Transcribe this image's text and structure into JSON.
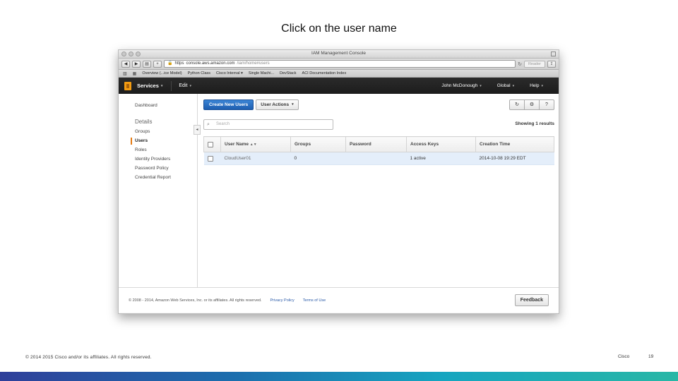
{
  "slide": {
    "title": "Click on the user name",
    "copyright": "© 2014 2015 Cisco and/or its affiliates. All rights reserved.",
    "company": "Cisco",
    "page_number": "19"
  },
  "browser": {
    "window_title": "IAM Management Console",
    "url_scheme": "https",
    "url_host": "console.aws.amazon.com",
    "url_path": "/iam/home#users",
    "reader_label": "Reader",
    "bookmarks": [
      "Overview (...ice Model)",
      "Python Class",
      "Cisco Internal ▾",
      "Single Machi...",
      "DevStack",
      "ACI Documentation Index"
    ]
  },
  "aws_nav": {
    "services_label": "Services",
    "edit_label": "Edit",
    "user_label": "John McDonough",
    "region_label": "Global",
    "help_label": "Help"
  },
  "sidebar": {
    "dashboard": "Dashboard",
    "details_header": "Details",
    "items": [
      "Groups",
      "Users",
      "Roles",
      "Identity Providers",
      "Password Policy",
      "Credential Report"
    ],
    "active": "Users"
  },
  "main": {
    "create_button": "Create New Users",
    "actions_button": "User Actions",
    "search_placeholder": "Search",
    "showing_text": "Showing 1 results",
    "columns": [
      "User Name",
      "Groups",
      "Password",
      "Access Keys",
      "Creation Time"
    ],
    "rows": [
      {
        "user_name": "CloudUser01",
        "groups": "0",
        "password": "",
        "access_keys": "1 active",
        "creation_time": "2014-10-08 19:29 EDT"
      }
    ]
  },
  "console_footer": {
    "copyright": "© 2008 - 2014, Amazon Web Services, Inc. or its affiliates. All rights reserved.",
    "privacy": "Privacy Policy",
    "terms": "Terms of Use",
    "feedback": "Feedback"
  },
  "colors": {
    "aws_orange": "#e47911",
    "primary_blue": "#1e5eb0",
    "row_highlight": "#e4eefa"
  }
}
